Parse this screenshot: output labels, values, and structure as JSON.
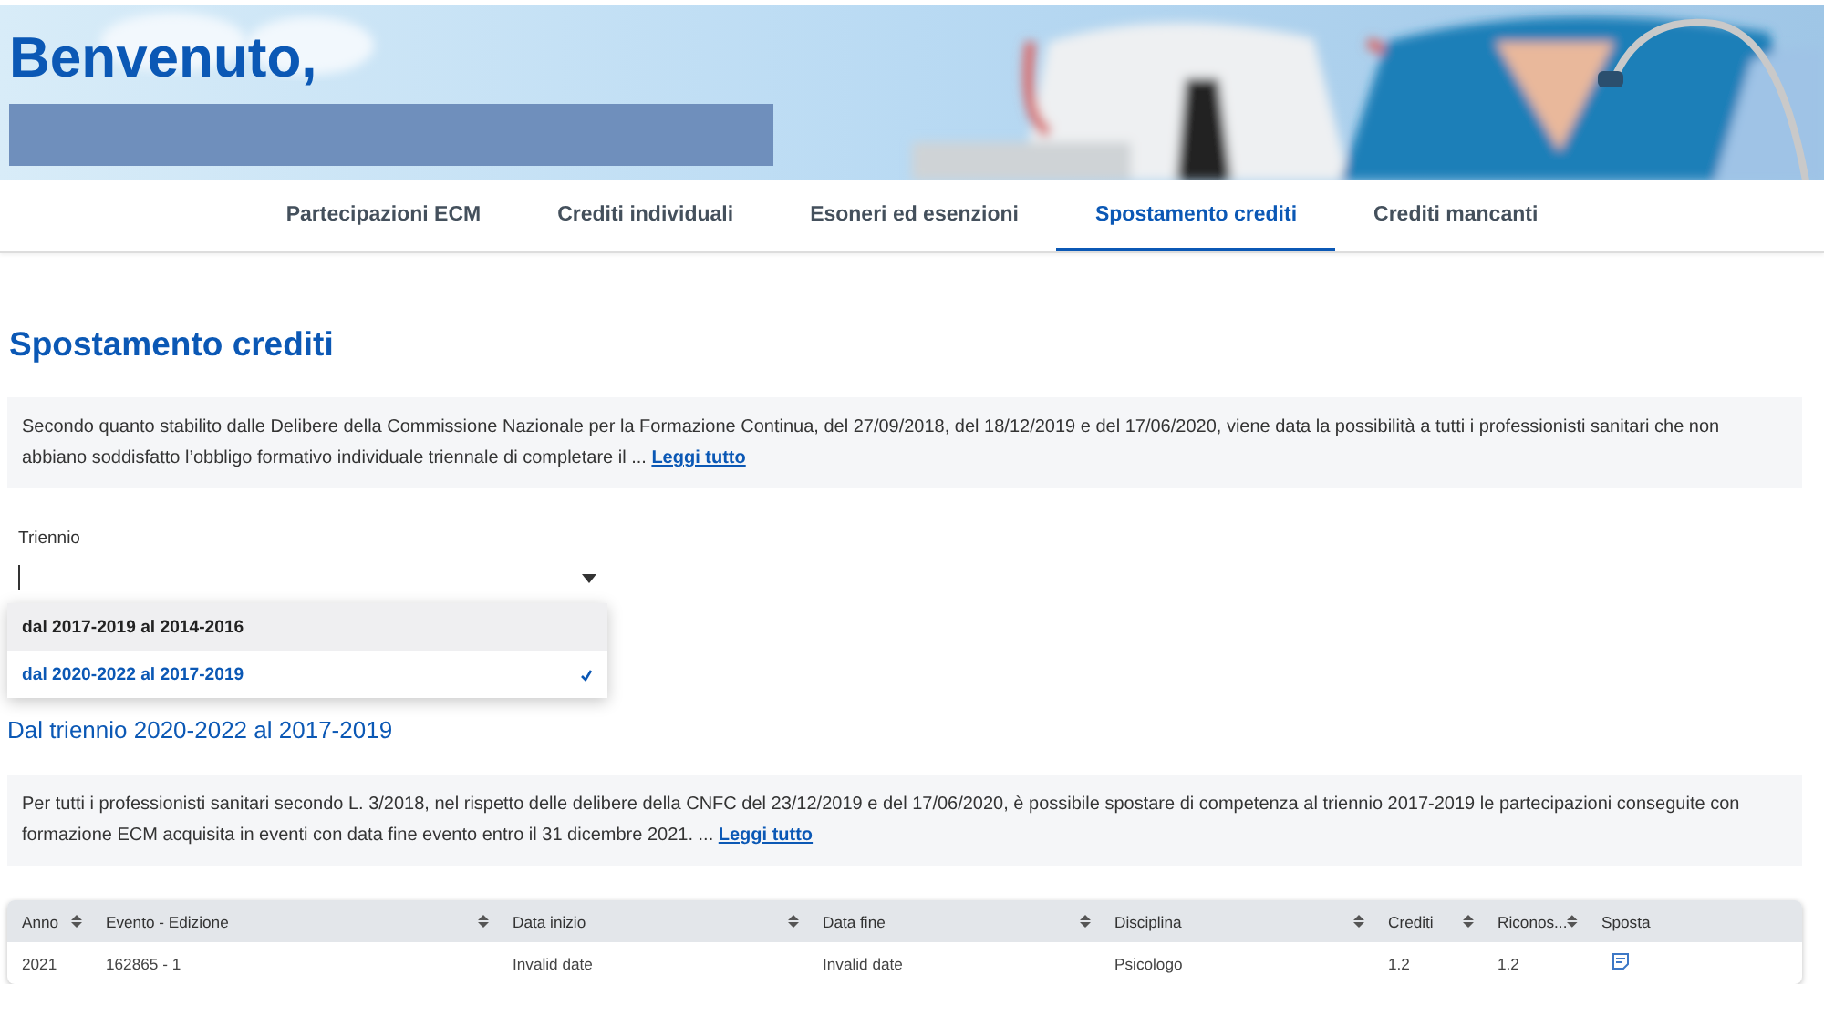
{
  "header": {
    "greeting": "Benvenuto,"
  },
  "tabs": [
    {
      "label": "Partecipazioni ECM",
      "selected": false
    },
    {
      "label": "Crediti individuali",
      "selected": false
    },
    {
      "label": "Esoneri ed esenzioni",
      "selected": false
    },
    {
      "label": "Spostamento crediti",
      "selected": true
    },
    {
      "label": "Crediti mancanti",
      "selected": false
    }
  ],
  "page_title": "Spostamento crediti",
  "intro": {
    "text": "Secondo quanto stabilito dalle Delibere della Commissione Nazionale per la Formazione Continua, del 27/09/2018, del 18/12/2019 e del 17/06/2020, viene data la possibilità a tutti i professionisti sanitari che non abbiano soddisfatto l’obbligo formativo individuale triennale di completare il ...",
    "link": "Leggi tutto"
  },
  "triennio_select": {
    "label": "Triennio",
    "expanded": true,
    "options": [
      {
        "label": "dal 2017-2019 al 2014-2016",
        "hovered": true,
        "selected": false
      },
      {
        "label": "dal 2020-2022 al 2017-2019",
        "hovered": false,
        "selected": true
      }
    ]
  },
  "section_title": "Dal triennio 2020-2022 al 2017-2019",
  "notice": {
    "text": "Per tutti i professionisti sanitari secondo L. 3/2018, nel rispetto delle delibere della CNFC del 23/12/2019 e del 17/06/2020, è possibile spostare di competenza al triennio 2017-2019 le partecipazioni conseguite con formazione ECM acquisita in eventi con data fine evento entro il 31 dicembre 2021. ...",
    "link": "Leggi tutto"
  },
  "table": {
    "columns": [
      {
        "label": "Anno",
        "sortable": true
      },
      {
        "label": "Evento - Edizione",
        "sortable": true
      },
      {
        "label": "Data inizio",
        "sortable": true
      },
      {
        "label": "Data fine",
        "sortable": true
      },
      {
        "label": "Disciplina",
        "sortable": true
      },
      {
        "label": "Crediti",
        "sortable": true
      },
      {
        "label": "Riconos...",
        "sortable": true
      },
      {
        "label": "Sposta",
        "sortable": false
      }
    ],
    "rows": [
      {
        "cells": [
          "2021",
          "162865 - 1",
          "Invalid date",
          "Invalid date",
          "Psicologo",
          "1.2",
          "1.2"
        ],
        "kind": "movable"
      }
    ]
  }
}
